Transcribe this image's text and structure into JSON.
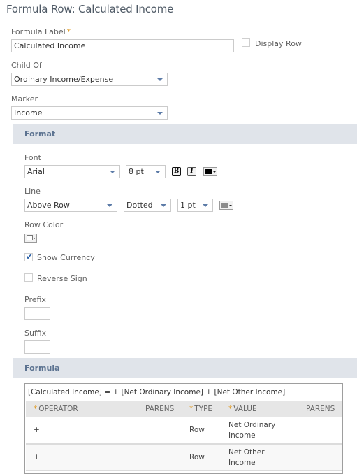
{
  "page": {
    "title": "Formula Row: Calculated Income"
  },
  "form": {
    "formula_label": {
      "label": "Formula Label",
      "required_mark": "*",
      "value": "Calculated Income"
    },
    "display_row": {
      "label": "Display Row",
      "checked": false
    },
    "child_of": {
      "label": "Child Of",
      "value": "Ordinary Income/Expense"
    },
    "marker": {
      "label": "Marker",
      "value": "Income"
    }
  },
  "format_section": {
    "title": "Format",
    "font": {
      "label": "Font",
      "family": "Arial",
      "size": "8 pt",
      "bold_icon_glyph": "B",
      "italic_icon_glyph": "I",
      "font_color": "#000000"
    },
    "line": {
      "label": "Line",
      "position": "Above Row",
      "style": "Dotted",
      "width": "1 pt",
      "line_color": "#808080"
    },
    "row_color": {
      "label": "Row Color",
      "color": "#ffffff"
    },
    "show_currency": {
      "label": "Show Currency",
      "checked": true
    },
    "reverse_sign": {
      "label": "Reverse Sign",
      "checked": false
    },
    "prefix": {
      "label": "Prefix",
      "value": ""
    },
    "suffix": {
      "label": "Suffix",
      "value": ""
    }
  },
  "formula_section": {
    "title": "Formula",
    "expression": "[Calculated Income] = + [Net Ordinary Income] + [Net Other Income]",
    "columns": [
      {
        "label": "OPERATOR",
        "required": "*"
      },
      {
        "label": "PARENS",
        "required": ""
      },
      {
        "label": "TYPE",
        "required": "*"
      },
      {
        "label": "VALUE",
        "required": "*"
      },
      {
        "label": "PARENS",
        "required": ""
      }
    ],
    "rows": [
      {
        "operator": "+",
        "open_parens": "",
        "type": "Row",
        "value_line1": "Net Ordinary",
        "value_line2": "Income",
        "close_parens": ""
      },
      {
        "operator": "+",
        "open_parens": "",
        "type": "Row",
        "value_line1": "Net Other",
        "value_line2": "Income",
        "close_parens": ""
      }
    ]
  },
  "colors": {
    "accent": "#5d7ca8",
    "required": "#e09b24",
    "section_bg": "#e0e4ea",
    "check": "#2a61a8"
  }
}
